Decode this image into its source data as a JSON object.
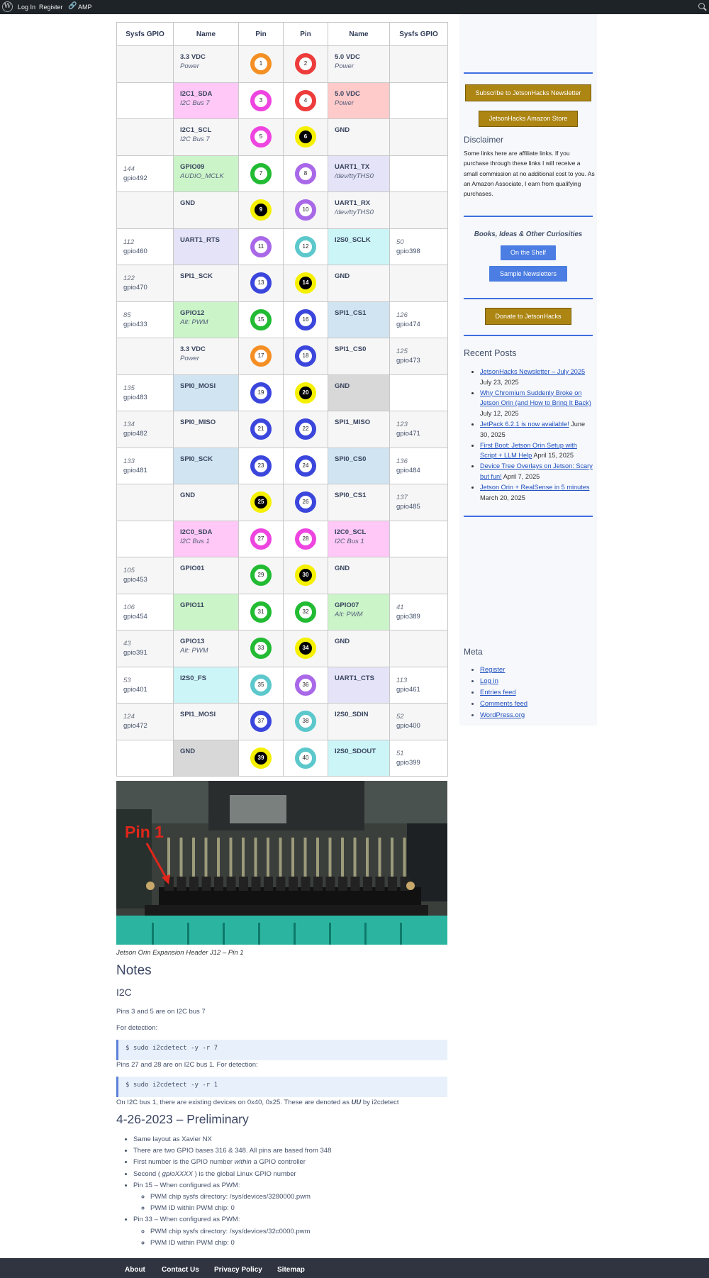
{
  "adminbar": {
    "login": "Log In",
    "register": "Register",
    "amp": "AMP"
  },
  "table": {
    "headers": [
      "Sysfs GPIO",
      "Name",
      "Pin",
      "Pin",
      "Name",
      "Sysfs GPIO"
    ],
    "rows": [
      {
        "ls1": "",
        "ls2": "",
        "ln1": "3.3 VDC",
        "ln2": "Power",
        "lbg": "",
        "lp": "1",
        "lc": "#f48f24",
        "ld": false,
        "rp": "2",
        "rc": "#ee3b3b",
        "rd": false,
        "rn1": "5.0 VDC",
        "rn2": "Power",
        "rbg": "",
        "rs1": "",
        "rs2": ""
      },
      {
        "ls1": "",
        "ls2": "",
        "ln1": "I2C1_SDA",
        "ln2": "I2C Bus 7",
        "lbg": "#ffc8f7",
        "lp": "3",
        "lc": "#ee44e0",
        "ld": false,
        "rp": "4",
        "rc": "#ee3b3b",
        "rd": false,
        "rn1": "5.0 VDC",
        "rn2": "Power",
        "rbg": "#ffcaca",
        "rs1": "",
        "rs2": ""
      },
      {
        "ls1": "",
        "ls2": "",
        "ln1": "I2C1_SCL",
        "ln2": "I2C Bus 7",
        "lbg": "",
        "lp": "5",
        "lc": "#ee44e0",
        "ld": false,
        "rp": "6",
        "rc": "#f5f000",
        "rd": true,
        "rn1": "GND",
        "rn2": "",
        "rbg": "",
        "rs1": "",
        "rs2": ""
      },
      {
        "ls1": "144",
        "ls2": "gpio492",
        "ln1": "GPIO09",
        "ln2": "AUDIO_MCLK",
        "lbg": "#cbf5c8",
        "lp": "7",
        "lc": "#22bb33",
        "ld": false,
        "rp": "8",
        "rc": "#a968e8",
        "rd": false,
        "rn1": "UART1_TX",
        "rn2": "/dev/ttyTHS0",
        "rbg": "#e4e3f7",
        "rs1": "",
        "rs2": ""
      },
      {
        "ls1": "",
        "ls2": "",
        "ln1": "GND",
        "ln2": "",
        "lbg": "",
        "lp": "9",
        "lc": "#f5f000",
        "ld": true,
        "rp": "10",
        "rc": "#a968e8",
        "rd": false,
        "rn1": "UART1_RX",
        "rn2": "/dev/ttyTHS0",
        "rbg": "",
        "rs1": "",
        "rs2": ""
      },
      {
        "ls1": "112",
        "ls2": "gpio460",
        "ln1": "UART1_RTS",
        "ln2": "",
        "lbg": "#e4e3f7",
        "lp": "11",
        "lc": "#a968e8",
        "ld": false,
        "rp": "12",
        "rc": "#5cc8cc",
        "rd": false,
        "rn1": "I2S0_SCLK",
        "rn2": "",
        "rbg": "#ccf5f7",
        "rs1": "50",
        "rs2": "gpio398"
      },
      {
        "ls1": "122",
        "ls2": "gpio470",
        "ln1": "SPI1_SCK",
        "ln2": "",
        "lbg": "",
        "lp": "13",
        "lc": "#3b46dc",
        "ld": false,
        "rp": "14",
        "rc": "#f5f000",
        "rd": true,
        "rn1": "GND",
        "rn2": "",
        "rbg": "",
        "rs1": "",
        "rs2": ""
      },
      {
        "ls1": "85",
        "ls2": "gpio433",
        "ln1": "GPIO12",
        "ln2": "Alt: PWM",
        "lbg": "#cbf5c8",
        "lp": "15",
        "lc": "#22bb33",
        "ld": false,
        "rp": "16",
        "rc": "#3b46dc",
        "rd": false,
        "rn1": "SPI1_CS1",
        "rn2": "",
        "rbg": "#d0e4f2",
        "rs1": "126",
        "rs2": "gpio474"
      },
      {
        "ls1": "",
        "ls2": "",
        "ln1": "3.3 VDC",
        "ln2": "Power",
        "lbg": "",
        "lp": "17",
        "lc": "#f48f24",
        "ld": false,
        "rp": "18",
        "rc": "#3b46dc",
        "rd": false,
        "rn1": "SPI1_CS0",
        "rn2": "",
        "rbg": "",
        "rs1": "125",
        "rs2": "gpio473"
      },
      {
        "ls1": "135",
        "ls2": "gpio483",
        "ln1": "SPI0_MOSI",
        "ln2": "",
        "lbg": "#d0e4f2",
        "lp": "19",
        "lc": "#3b46dc",
        "ld": false,
        "rp": "20",
        "rc": "#f5f000",
        "rd": true,
        "rn1": "GND",
        "rn2": "",
        "rbg": "#d8d8d8",
        "rs1": "",
        "rs2": ""
      },
      {
        "ls1": "134",
        "ls2": "gpio482",
        "ln1": "SPI0_MISO",
        "ln2": "",
        "lbg": "",
        "lp": "21",
        "lc": "#3b46dc",
        "ld": false,
        "rp": "22",
        "rc": "#3b46dc",
        "rd": false,
        "rn1": "SPI1_MISO",
        "rn2": "",
        "rbg": "",
        "rs1": "123",
        "rs2": "gpio471"
      },
      {
        "ls1": "133",
        "ls2": "gpio481",
        "ln1": "SPI0_SCK",
        "ln2": "",
        "lbg": "#d0e4f2",
        "lp": "23",
        "lc": "#3b46dc",
        "ld": false,
        "rp": "24",
        "rc": "#3b46dc",
        "rd": false,
        "rn1": "SPI0_CS0",
        "rn2": "",
        "rbg": "#d0e4f2",
        "rs1": "136",
        "rs2": "gpio484"
      },
      {
        "ls1": "",
        "ls2": "",
        "ln1": "GND",
        "ln2": "",
        "lbg": "",
        "lp": "25",
        "lc": "#f5f000",
        "ld": true,
        "rp": "26",
        "rc": "#3b46dc",
        "rd": false,
        "rn1": "SPI0_CS1",
        "rn2": "",
        "rbg": "",
        "rs1": "137",
        "rs2": "gpio485"
      },
      {
        "ls1": "",
        "ls2": "",
        "ln1": "I2C0_SDA",
        "ln2": "I2C Bus 1",
        "lbg": "#ffc8f7",
        "lp": "27",
        "lc": "#ee44e0",
        "ld": false,
        "rp": "28",
        "rc": "#ee44e0",
        "rd": false,
        "rn1": "I2C0_SCL",
        "rn2": "I2C Bus 1",
        "rbg": "#ffc8f7",
        "rs1": "",
        "rs2": ""
      },
      {
        "ls1": "105",
        "ls2": "gpio453",
        "ln1": "GPIO01",
        "ln2": "",
        "lbg": "",
        "lp": "29",
        "lc": "#22bb33",
        "ld": false,
        "rp": "30",
        "rc": "#f5f000",
        "rd": true,
        "rn1": "GND",
        "rn2": "",
        "rbg": "",
        "rs1": "",
        "rs2": ""
      },
      {
        "ls1": "106",
        "ls2": "gpio454",
        "ln1": "GPIO11",
        "ln2": "",
        "lbg": "#cbf5c8",
        "lp": "31",
        "lc": "#22bb33",
        "ld": false,
        "rp": "32",
        "rc": "#22bb33",
        "rd": false,
        "rn1": "GPIO07",
        "rn2": "Alt: PWM",
        "rbg": "#cbf5c8",
        "rs1": "41",
        "rs2": "gpio389"
      },
      {
        "ls1": "43",
        "ls2": "gpio391",
        "ln1": "GPIO13",
        "ln2": "Alt: PWM",
        "lbg": "",
        "lp": "33",
        "lc": "#22bb33",
        "ld": false,
        "rp": "34",
        "rc": "#f5f000",
        "rd": true,
        "rn1": "GND",
        "rn2": "",
        "rbg": "",
        "rs1": "",
        "rs2": ""
      },
      {
        "ls1": "53",
        "ls2": "gpio401",
        "ln1": "I2S0_FS",
        "ln2": "",
        "lbg": "#ccf5f7",
        "lp": "35",
        "lc": "#5cc8cc",
        "ld": false,
        "rp": "36",
        "rc": "#a968e8",
        "rd": false,
        "rn1": "UART1_CTS",
        "rn2": "",
        "rbg": "#e4e3f7",
        "rs1": "113",
        "rs2": "gpio461"
      },
      {
        "ls1": "124",
        "ls2": "gpio472",
        "ln1": "SPI1_MOSI",
        "ln2": "",
        "lbg": "",
        "lp": "37",
        "lc": "#3b46dc",
        "ld": false,
        "rp": "38",
        "rc": "#5cc8cc",
        "rd": false,
        "rn1": "I2S0_SDIN",
        "rn2": "",
        "rbg": "",
        "rs1": "52",
        "rs2": "gpio400"
      },
      {
        "ls1": "",
        "ls2": "",
        "ln1": "GND",
        "ln2": "",
        "lbg": "#d8d8d8",
        "lp": "39",
        "lc": "#f5f000",
        "ld": true,
        "rp": "40",
        "rc": "#5cc8cc",
        "rd": false,
        "rn1": "I2S0_SDOUT",
        "rn2": "",
        "rbg": "#ccf5f7",
        "rs1": "51",
        "rs2": "gpio399"
      }
    ]
  },
  "sidebar": {
    "subscribe": "Subscribe to JetsonHacks Newsletter",
    "store": "JetsonHacks Amazon Store",
    "disclaimer_title": "Disclaimer",
    "disclaimer_text": "Some links here are affiliate links. If you purchase through these links I will receive a small commission at no additional cost to you. As an Amazon Associate, I earn from qualifying purchases.",
    "books_title": "Books, Ideas & Other Curiosities",
    "on_shelf": "On the Shelf",
    "sample": "Sample Newsletters",
    "donate": "Donate to JetsonHacks",
    "recent_title": "Recent Posts",
    "posts": [
      {
        "title": "JetsonHacks Newsletter – July 2025",
        "date": "July 23, 2025"
      },
      {
        "title": "Why Chromium Suddenly Broke on Jetson Orin (and How to Bring It Back)",
        "date": "July 12, 2025"
      },
      {
        "title": "JetPack 6.2.1 is now available!",
        "date": "June 30, 2025"
      },
      {
        "title": "First Boot: Jetson Orin Setup with Script + LLM Help",
        "date": "April 15, 2025"
      },
      {
        "title": "Device Tree Overlays on Jetson: Scary but fun!",
        "date": "April 7, 2025"
      },
      {
        "title": "Jetson Orin + RealSense in 5 minutes",
        "date": "March 20, 2025"
      }
    ],
    "meta_title": "Meta",
    "meta": [
      "Register",
      "Log in",
      "Entries feed",
      "Comments feed",
      "WordPress.org"
    ]
  },
  "photo": {
    "overlay": "Pin 1",
    "caption": "Jetson Orin Expansion Header J12 – Pin 1"
  },
  "notes": {
    "title": "Notes",
    "i2c_title": "I2C",
    "p1": "Pins 3 and 5 are on I2C bus 7",
    "p2": "For detection:",
    "code1": "$ sudo i2cdetect -y -r 7",
    "p3": "Pins 27 and 28 are on I2C bus 1. For detection:",
    "code2": "$ sudo i2cdetect -y -r 1",
    "p4a": "On I2C bus 1, there are existing devices on 0x40, 0x25. These are denoted as ",
    "p4b": "UU",
    "p4c": " by i2cdetect",
    "prelim_title": "4-26-2023 – Preliminary",
    "list": {
      "i1": "Same layout as Xavier NX",
      "i2": "There are two GPIO bases 316 & 348. All pins are based from 348",
      "i3a": "First number is the GPIO number ",
      "i3b": "within",
      "i3c": " a GPIO controller",
      "i4a": "Second ( ",
      "i4b": "gpioXXXX",
      "i4c": " ) is the global Linux GPIO number",
      "i5": "Pin 15 – When configured as PWM:",
      "i5s1": "PWM chip sysfs directory: /sys/devices/3280000.pwm",
      "i5s2": "PWM ID within PWM chip: 0",
      "i6": "Pin 33 – When configured as PWM:",
      "i6s1": "PWM chip sysfs directory: /sys/devices/32c0000.pwm",
      "i6s2": "PWM ID within PWM chip: 0"
    }
  },
  "footer": [
    "About",
    "Contact Us",
    "Privacy Policy",
    "Sitemap"
  ]
}
